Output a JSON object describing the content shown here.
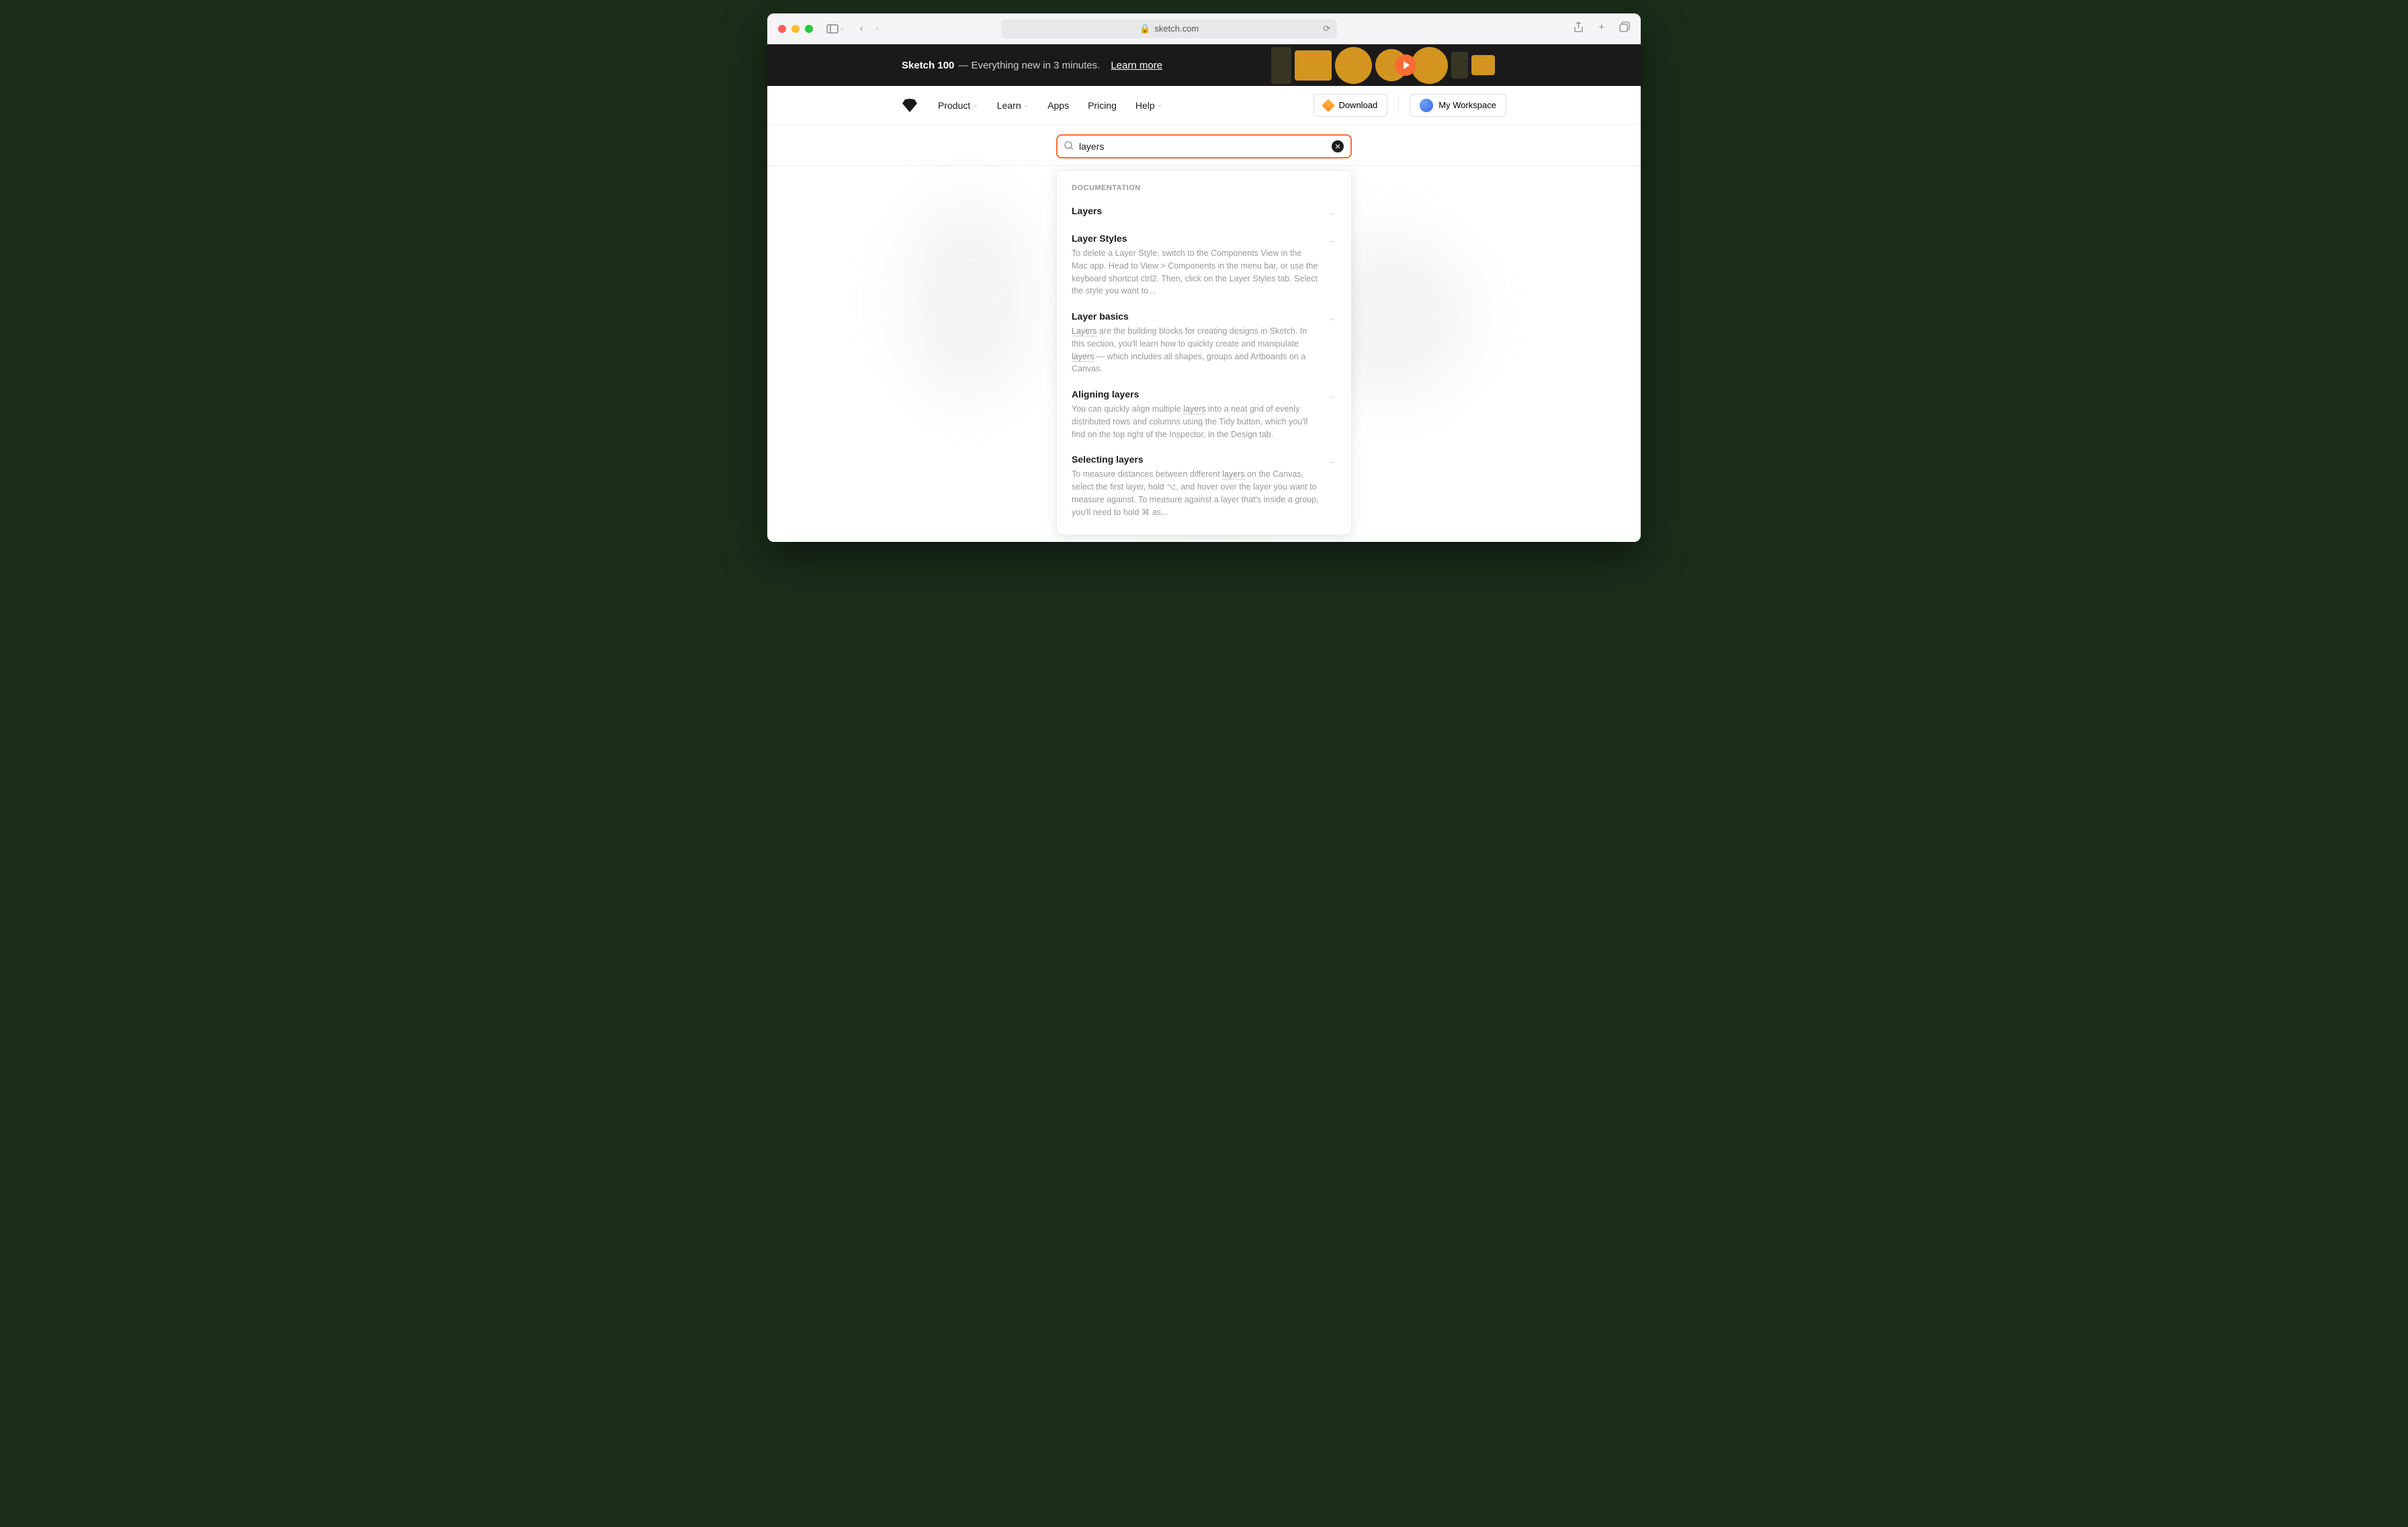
{
  "browser": {
    "url": "sketch.com"
  },
  "banner": {
    "title": "Sketch 100",
    "subtitle": "— Everything new in 3 minutes.",
    "link": "Learn more"
  },
  "nav": {
    "items": [
      {
        "label": "Product",
        "hasDropdown": true
      },
      {
        "label": "Learn",
        "hasDropdown": true
      },
      {
        "label": "Apps",
        "hasDropdown": false
      },
      {
        "label": "Pricing",
        "hasDropdown": false
      },
      {
        "label": "Help",
        "hasDropdown": true
      }
    ],
    "download": "Download",
    "workspace": "My Workspace"
  },
  "search": {
    "value": "layers",
    "placeholder": "Search"
  },
  "dropdown": {
    "section": "DOCUMENTATION",
    "results": [
      {
        "title": "Layers",
        "desc": ""
      },
      {
        "title": "Layer Styles",
        "desc": "To delete a Layer Style, switch to the Components View in the Mac app. Head to View > Components in the menu bar, or use the keyboard shortcut ctrl2. Then, click on the Layer Styles tab. Select the style you want to..."
      },
      {
        "title": "Layer basics",
        "desc": "<hl>Layers</hl> are the building blocks for creating designs in Sketch. In this section, you'll learn how to quickly create and manipulate <hl>layers</hl> — which includes all shapes, groups and Artboards on a Canvas."
      },
      {
        "title": "Aligning layers",
        "desc": "You can quickly align multiple <hl>layers</hl> into a neat grid of evenly distributed rows and columns using the Tidy button, which you'll find on the top right of the Inspector, in the Design tab."
      },
      {
        "title": "Selecting layers",
        "desc": "To measure distances between different <hl>layers</hl> on the Canvas, select the first layer, hold ⌥, and hover over the layer you want to measure against. To measure against a layer that's inside a group, you'll need to hold ⌘ as..."
      }
    ]
  }
}
